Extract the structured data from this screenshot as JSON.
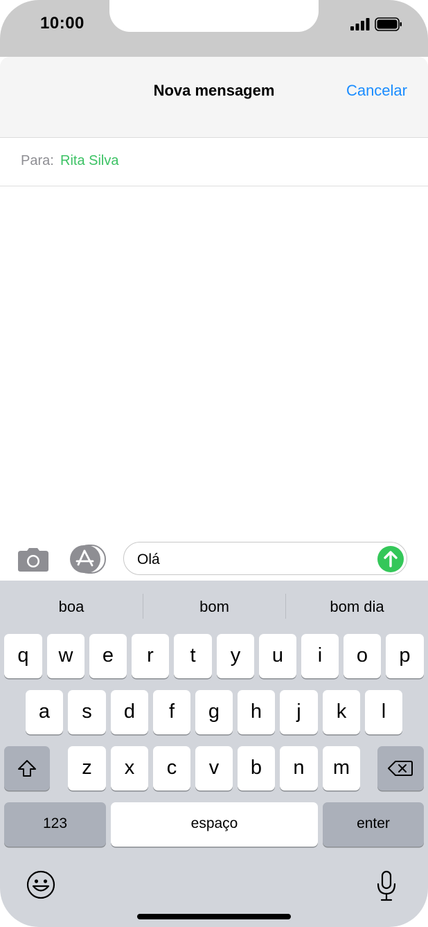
{
  "status_bar": {
    "time": "10:00"
  },
  "header": {
    "title": "Nova mensagem",
    "cancel_label": "Cancelar"
  },
  "recipient": {
    "label": "Para:",
    "name": "Rita Silva"
  },
  "compose": {
    "message_text": "Olá"
  },
  "keyboard": {
    "suggestions": [
      "boa",
      "bom",
      "bom dia"
    ],
    "row1": [
      "q",
      "w",
      "e",
      "r",
      "t",
      "y",
      "u",
      "i",
      "o",
      "p"
    ],
    "row2": [
      "a",
      "s",
      "d",
      "f",
      "g",
      "h",
      "j",
      "k",
      "l"
    ],
    "row3": [
      "z",
      "x",
      "c",
      "v",
      "b",
      "n",
      "m"
    ],
    "numbers_label": "123",
    "space_label": "espaço",
    "enter_label": "enter"
  },
  "colors": {
    "accent_blue": "#1a8cff",
    "contact_green": "#3cc264",
    "send_green": "#34c759"
  },
  "icons": [
    "camera-icon",
    "app-store-icon",
    "send-arrow-icon",
    "shift-icon",
    "backspace-icon",
    "emoji-icon",
    "microphone-icon",
    "signal-icon",
    "battery-icon"
  ]
}
